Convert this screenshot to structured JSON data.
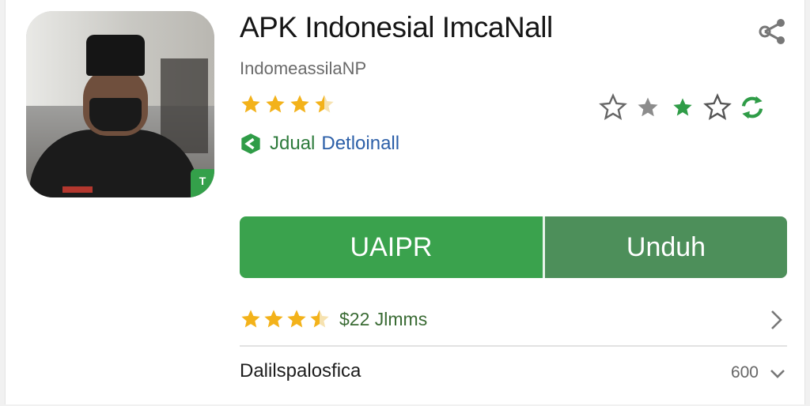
{
  "app": {
    "title": "APK Indonesial ImcaNall",
    "developer": "IndomeassilaNP",
    "icon_badge": "T"
  },
  "rating": {
    "stars_filled": 3.5,
    "stars_total": 4
  },
  "actions": {
    "icons": [
      "star-outline-icon",
      "star-gray-icon",
      "star-green-icon",
      "star-outline-icon",
      "refresh-icon"
    ]
  },
  "detail": {
    "part1": "Jdual",
    "part2": "Detloinall"
  },
  "buttons": {
    "primary_label": "UAIPR",
    "download_label": "Unduh"
  },
  "reviews": {
    "stars_filled": 3.5,
    "stars_total": 4,
    "count_label": "$22 Jlmms"
  },
  "info": {
    "label": "Dalilspalosfica",
    "value": "600"
  },
  "colors": {
    "star": "#f3b21a",
    "green_primary": "#3aa24d",
    "green_dark": "#4d8f5a",
    "link_blue": "#2c5fa8"
  }
}
